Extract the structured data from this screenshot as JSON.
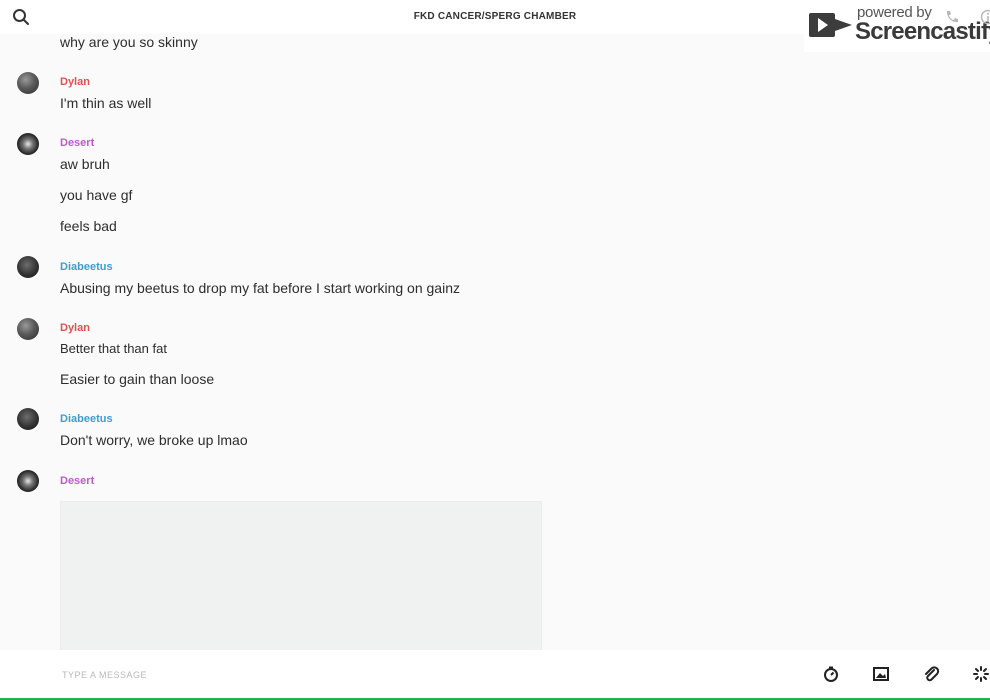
{
  "header": {
    "title": "FKD CANCER/SPERG CHAMBER",
    "icons": [
      "search-icon",
      "phone-icon",
      "info-icon"
    ]
  },
  "watermark": {
    "top_text": "powered by",
    "brand": "Screencastify"
  },
  "authors": {
    "dylan": {
      "name": "Dylan",
      "color": "#e0524f"
    },
    "desert": {
      "name": "Desert",
      "color": "#c157d3"
    },
    "diabeetus": {
      "name": "Diabeetus",
      "color": "#3a9fd0"
    }
  },
  "messages": [
    {
      "text": "why are you so skinny"
    },
    {
      "author": "Dylan",
      "text": "I'm thin as well"
    },
    {
      "author": "Desert",
      "text": "aw bruh"
    },
    {
      "text": "you have gf"
    },
    {
      "text": "feels bad"
    },
    {
      "author": "Diabeetus",
      "text": "Abusing my beetus to drop my fat before I start working on gainz"
    },
    {
      "author": "Dylan",
      "text": "Better that than fat"
    },
    {
      "text": "Easier to gain than loose"
    },
    {
      "author": "Diabeetus",
      "text": "Don't worry, we broke up lmao"
    },
    {
      "author": "Desert",
      "attachment": "image"
    }
  ],
  "composer": {
    "placeholder": "TYPE A MESSAGE",
    "tools": [
      "timer-icon",
      "image-icon",
      "paperclip-icon",
      "sparkle-icon"
    ]
  },
  "colors": {
    "background": "#fafafa",
    "accent_bottom": "#19b44a"
  }
}
